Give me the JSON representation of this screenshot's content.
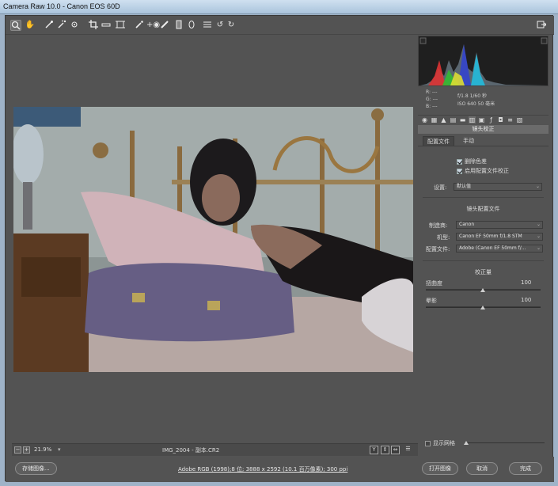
{
  "window": {
    "title": "Camera Raw 10.0 -  Canon EOS 60D"
  },
  "toolbar": {
    "tools": [
      "zoom-icon",
      "hand-icon",
      "white-balance-icon",
      "color-sampler-icon",
      "target-adjust-icon",
      "crop-icon",
      "straighten-icon",
      "transform-icon",
      "spot-removal-icon",
      "red-eye-icon",
      "adjustment-brush-icon",
      "graduated-filter-icon",
      "radial-filter-icon",
      "list-icon",
      "rotate-ccw-icon",
      "rotate-cw-icon"
    ],
    "right_icon": "export-icon"
  },
  "histogram": {
    "readout_r": "R:  ---",
    "readout_g": "G:  ---",
    "readout_b": "B:  ---",
    "exif_line1": "f/1.8   1/60 秒",
    "exif_line2": "ISO 640   50 毫米"
  },
  "panel": {
    "section_title": "镜头校正",
    "tabs": [
      "配置文件",
      "手动"
    ],
    "checkbox_remove_ca": "删除色差",
    "checkbox_enable_profile": "启用配置文件校正",
    "settings_label": "设置:",
    "settings_value": "默认值",
    "profile_section": "镜头配置文件",
    "make_label": "制造商:",
    "make_value": "Canon",
    "model_label": "机型:",
    "model_value": "Canon EF 50mm f/1.8 STM",
    "profile_label": "配置文件:",
    "profile_value": "Adobe (Canon EF 50mm f/...",
    "correction_section": "校正量",
    "distortion_label": "扭曲度",
    "distortion_value": "100",
    "vignetting_label": "晕影",
    "vignetting_value": "100",
    "grid_label": "显示网格"
  },
  "status": {
    "zoom_minus": "−",
    "zoom_plus": "+",
    "zoom_value": "21.9%",
    "filename": "IMG_2004 - 副本.CR2",
    "view_y": "Y"
  },
  "footer": {
    "save_label": "存储图像...",
    "workflow_text": "Adobe RGB (1998);8 位; 3888 x 2592 (10.1 百万像素); 300 ppi",
    "open_label": "打开图像",
    "cancel_label": "取消",
    "done_label": "完成"
  }
}
